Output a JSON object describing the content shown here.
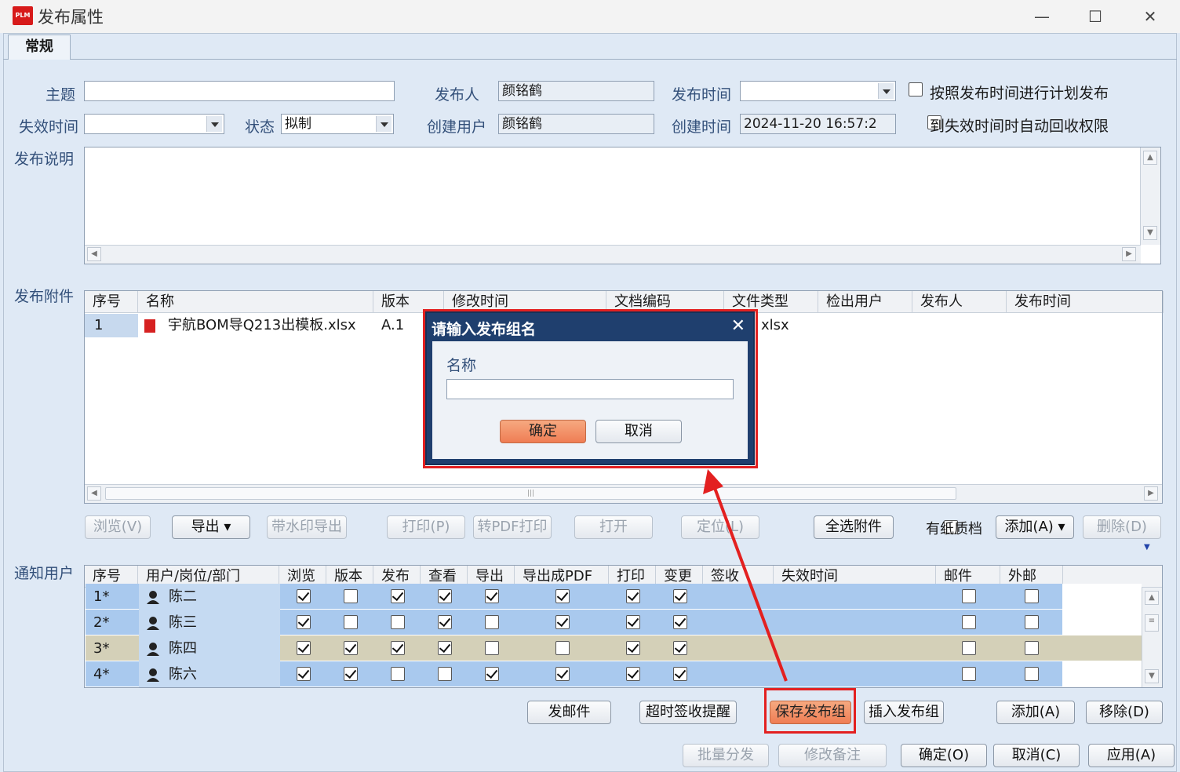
{
  "window": {
    "title": "发布属性",
    "app_icon_text": "PLM",
    "minimize": "—",
    "maximize": "☐",
    "close": "✕"
  },
  "tabs": [
    {
      "label": "常规"
    }
  ],
  "form": {
    "subject_label": "主题",
    "subject_value": "",
    "publisher_label": "发布人",
    "publisher_value": "颜铭鹤",
    "publish_time_label": "发布时间",
    "publish_time_value": "",
    "plan_publish_label": "按照发布时间进行计划发布",
    "expire_label": "失效时间",
    "expire_value": "",
    "status_label": "状态",
    "status_value": "拟制",
    "creator_label": "创建用户",
    "creator_value": "颜铭鹤",
    "create_time_label": "创建时间",
    "create_time_value": "2024-11-20 16:57:2",
    "auto_revoke_label": "到失效时间时自动回收权限",
    "description_label": "发布说明",
    "description_value": ""
  },
  "attachments": {
    "section_label": "发布附件",
    "columns": [
      "序号",
      "名称",
      "版本",
      "修改时间",
      "文档编码",
      "文件类型",
      "检出用户",
      "发布人",
      "发布时间"
    ],
    "rows": [
      {
        "no": "1",
        "name": "宇航BOM导Q213出模板.xlsx",
        "version": "A.1",
        "type": "xlsx"
      }
    ],
    "hscroll_mark": "|||",
    "buttons": {
      "browse": "浏览(V)",
      "export": "导出 ▾",
      "watermark_export": "带水印导出",
      "print": "打印(P)",
      "pdf_print": "转PDF打印",
      "open": "打开",
      "locate": "定位(L)",
      "select_all": "全选附件",
      "paper_archive": "有纸质档",
      "add": "添加(A) ▾",
      "delete": "删除(D)"
    }
  },
  "notify": {
    "section_label": "通知用户",
    "columns": [
      "序号",
      "用户/岗位/部门",
      "浏览",
      "版本",
      "发布",
      "查看",
      "导出",
      "导出成PDF",
      "打印",
      "变更",
      "签收",
      "失效时间",
      "邮件",
      "外邮"
    ],
    "rows": [
      {
        "no": "1*",
        "name": "陈二",
        "checks": [
          true,
          false,
          true,
          true,
          true,
          true,
          true,
          true
        ],
        "mail": false,
        "ext": false
      },
      {
        "no": "2*",
        "name": "陈三",
        "checks": [
          true,
          false,
          false,
          true,
          false,
          true,
          true,
          true
        ],
        "mail": false,
        "ext": false
      },
      {
        "no": "3*",
        "name": "陈四",
        "checks": [
          true,
          true,
          true,
          true,
          false,
          false,
          true,
          true
        ],
        "mail": false,
        "ext": false
      },
      {
        "no": "4*",
        "name": "陈六",
        "checks": [
          true,
          true,
          false,
          false,
          true,
          true,
          true,
          true
        ],
        "mail": false,
        "ext": false
      }
    ],
    "buttons": {
      "send_mail": "发邮件",
      "overdue_remind": "超时签收提醒",
      "save_group": "保存发布组",
      "insert_group": "插入发布组",
      "add": "添加(A)",
      "remove": "移除(D)"
    }
  },
  "footer": {
    "batch": "批量分发",
    "edit_note": "修改备注",
    "ok": "确定(O)",
    "cancel": "取消(C)",
    "apply": "应用(A)"
  },
  "dialog": {
    "title": "请输入发布组名",
    "close": "✕",
    "name_label": "名称",
    "name_value": "",
    "ok": "确定",
    "cancel": "取消"
  },
  "colors": {
    "accent_red": "#e32020",
    "row_blue": "#a9c9ee",
    "row_selected": "#d4d0b8",
    "dialog_title_bg": "#1f3f6e",
    "primary_orange": "#ef7d54"
  }
}
